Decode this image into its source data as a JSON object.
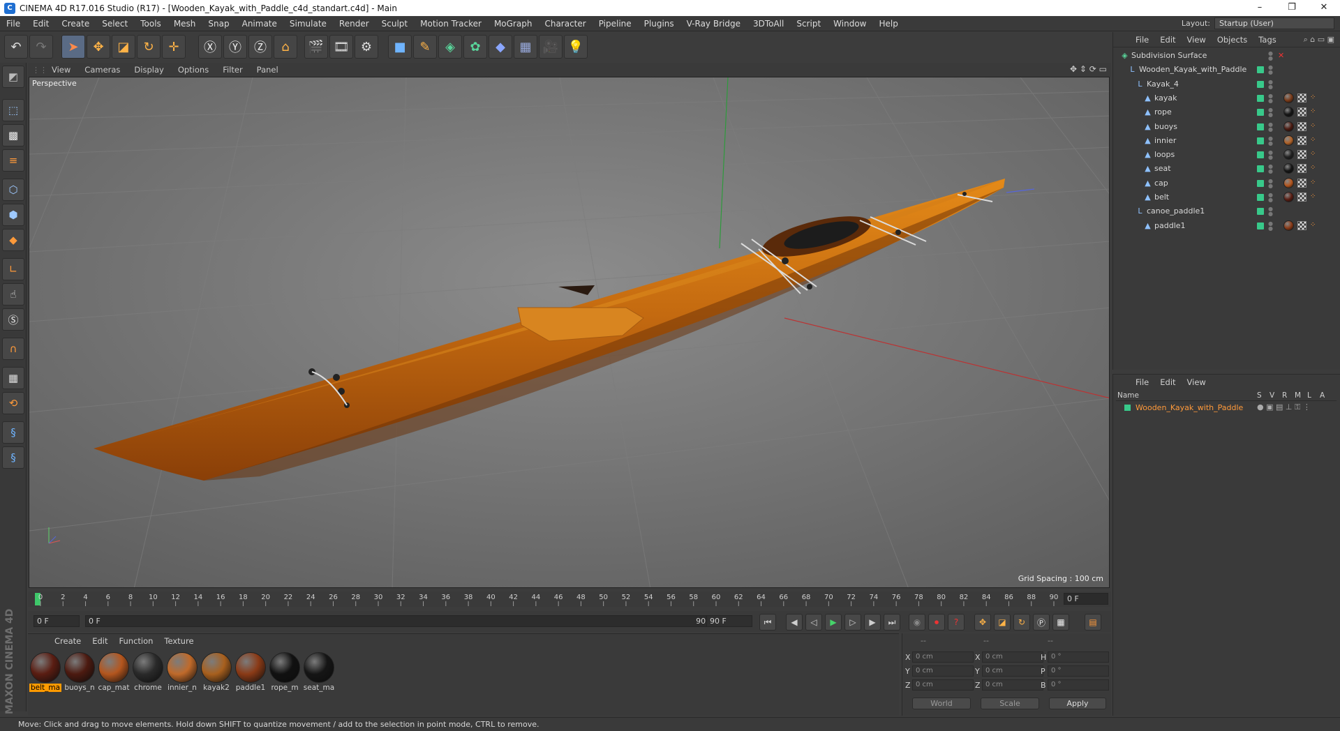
{
  "window": {
    "title": "CINEMA 4D R17.016 Studio (R17) - [Wooden_Kayak_with_Paddle_c4d_standart.c4d] - Main",
    "controls": [
      "–",
      "❐",
      "✕"
    ]
  },
  "menubar": {
    "items": [
      "File",
      "Edit",
      "Create",
      "Select",
      "Tools",
      "Mesh",
      "Snap",
      "Animate",
      "Simulate",
      "Render",
      "Sculpt",
      "Motion Tracker",
      "MoGraph",
      "Character",
      "Pipeline",
      "Plugins",
      "V-Ray Bridge",
      "3DToAll",
      "Script",
      "Window",
      "Help"
    ],
    "layout_label": "Layout:",
    "layout_value": "Startup (User)"
  },
  "viewport": {
    "menu": [
      "View",
      "Cameras",
      "Display",
      "Options",
      "Filter",
      "Panel"
    ],
    "camera_label": "Perspective",
    "grid_spacing": "Grid Spacing : 100 cm"
  },
  "timeline": {
    "ticks": [
      "0",
      "2",
      "4",
      "6",
      "8",
      "10",
      "12",
      "14",
      "16",
      "18",
      "20",
      "22",
      "24",
      "26",
      "28",
      "30",
      "32",
      "34",
      "36",
      "38",
      "40",
      "42",
      "44",
      "46",
      "48",
      "50",
      "52",
      "54",
      "56",
      "58",
      "60",
      "62",
      "64",
      "66",
      "68",
      "70",
      "72",
      "74",
      "76",
      "78",
      "80",
      "82",
      "84",
      "86",
      "88",
      "90"
    ],
    "current_frame": "0 F"
  },
  "anim": {
    "start_field": "0 F",
    "range_start": "0 F",
    "range_end": "90 F",
    "end_field": "90 F"
  },
  "materials": {
    "menu": [
      "Create",
      "Edit",
      "Function",
      "Texture"
    ],
    "items": [
      {
        "label": "belt_ma",
        "color": "#5a1d12",
        "selected": true
      },
      {
        "label": "buoys_n",
        "color": "#4c1a10",
        "selected": false
      },
      {
        "label": "cap_mat",
        "color": "#b4561e",
        "selected": false
      },
      {
        "label": "chrome",
        "color": "#2a2a2a",
        "selected": false
      },
      {
        "label": "innier_n",
        "color": "#c06a2a",
        "selected": false
      },
      {
        "label": "kayak2",
        "color": "#a8601e",
        "selected": false
      },
      {
        "label": "paddle1",
        "color": "#8a3a16",
        "selected": false
      },
      {
        "label": "rope_m",
        "color": "#111111",
        "selected": false
      },
      {
        "label": "seat_ma",
        "color": "#151515",
        "selected": false
      }
    ],
    "logo_text": "MAXON CINEMA 4D"
  },
  "coords": {
    "header": [
      "--",
      "--",
      "--"
    ],
    "rows": [
      {
        "a": "X",
        "v1": "0 cm",
        "b": "X",
        "v2": "0 cm",
        "c": "H",
        "v3": "0 °"
      },
      {
        "a": "Y",
        "v1": "0 cm",
        "b": "Y",
        "v2": "0 cm",
        "c": "P",
        "v3": "0 °"
      },
      {
        "a": "Z",
        "v1": "0 cm",
        "b": "Z",
        "v2": "0 cm",
        "c": "B",
        "v3": "0 °"
      }
    ],
    "space": "World",
    "mode": "Scale",
    "apply": "Apply"
  },
  "objects": {
    "menu": [
      "File",
      "Edit",
      "View",
      "Objects",
      "Tags"
    ],
    "tree": [
      {
        "name": "Subdivision Surface",
        "depth": 0,
        "icon": "subdivision-icon",
        "tags": []
      },
      {
        "name": "Wooden_Kayak_with_Paddle",
        "depth": 1,
        "icon": "null-icon",
        "tags": []
      },
      {
        "name": "Kayak_4",
        "depth": 2,
        "icon": "null-icon",
        "tags": []
      },
      {
        "name": "kayak",
        "depth": 3,
        "icon": "polygon-icon",
        "tags": [
          "#7a3a18"
        ]
      },
      {
        "name": "rope",
        "depth": 3,
        "icon": "polygon-icon",
        "tags": [
          "#151515"
        ]
      },
      {
        "name": "buoys",
        "depth": 3,
        "icon": "polygon-icon",
        "tags": [
          "#4c1a10"
        ]
      },
      {
        "name": "innier",
        "depth": 3,
        "icon": "polygon-icon",
        "tags": [
          "#b06228"
        ]
      },
      {
        "name": "loops",
        "depth": 3,
        "icon": "polygon-icon",
        "tags": [
          "#222222"
        ]
      },
      {
        "name": "seat",
        "depth": 3,
        "icon": "polygon-icon",
        "tags": [
          "#151515"
        ]
      },
      {
        "name": "cap",
        "depth": 3,
        "icon": "polygon-icon",
        "tags": [
          "#b4561e"
        ]
      },
      {
        "name": "belt",
        "depth": 3,
        "icon": "polygon-icon",
        "tags": [
          "#5a1d12"
        ]
      },
      {
        "name": "canoe_paddle1",
        "depth": 2,
        "icon": "null-icon",
        "tags": []
      },
      {
        "name": "paddle1",
        "depth": 3,
        "icon": "polygon-icon",
        "tags": [
          "#8a3a16"
        ]
      }
    ]
  },
  "layers": {
    "menu": [
      "File",
      "Edit",
      "View"
    ],
    "head_name": "Name",
    "head_cols": [
      "S",
      "V",
      "R",
      "M",
      "L",
      "A"
    ],
    "row_name": "Wooden_Kayak_with_Paddle"
  },
  "status": {
    "text": "Move: Click and drag to move elements. Hold down SHIFT to quantize movement / add to the selection in point mode, CTRL to remove."
  }
}
